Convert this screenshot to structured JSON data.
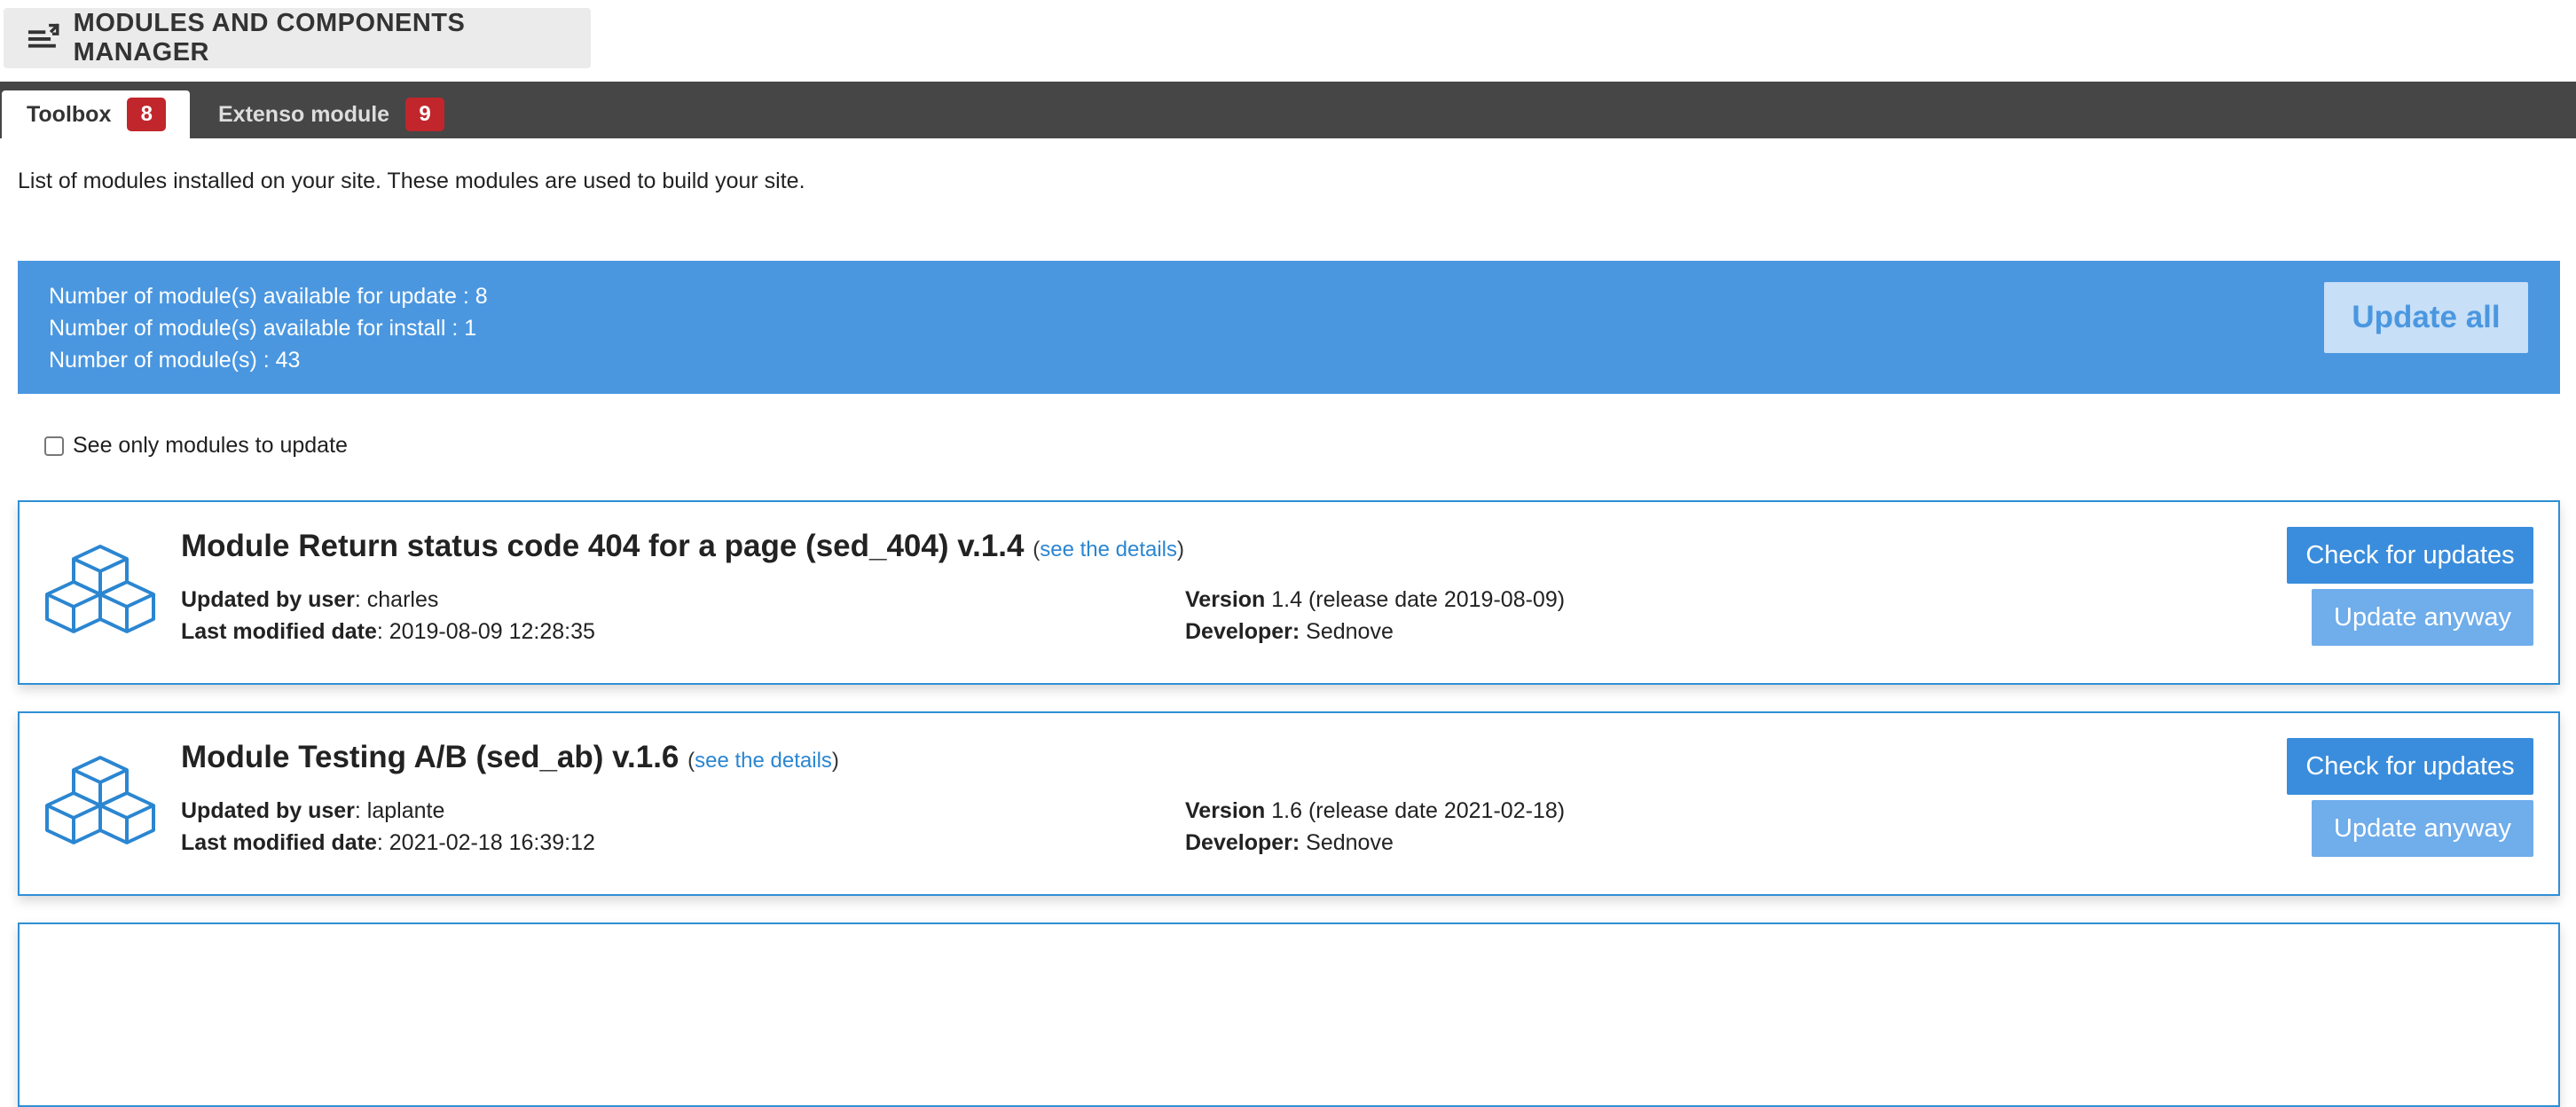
{
  "header": {
    "title": "MODULES AND COMPONENTS MANAGER",
    "icon": "module-settings-icon"
  },
  "tabs": [
    {
      "label": "Toolbox",
      "count": "8",
      "active": true
    },
    {
      "label": "Extenso module",
      "count": "9",
      "active": false
    }
  ],
  "intro": "List of modules installed on your site. These modules are used to build your site.",
  "summary": {
    "update_available": "Number of module(s) available for update : 8",
    "install_available": "Number of module(s) available for install : 1",
    "total": "Number of module(s) : 43",
    "update_all_label": "Update all"
  },
  "filter": {
    "label": "See only modules to update"
  },
  "labels": {
    "updated_by": "Updated by user",
    "last_modified": "Last modified date",
    "version": "Version",
    "developer": "Developer:",
    "see_details": "see the details",
    "check_updates": "Check for updates",
    "update_anyway": "Update anyway"
  },
  "modules": [
    {
      "name": "Module Return status code 404 for a page (sed_404) v.1.4",
      "updated_by": "charles",
      "last_modified": "2019-08-09 12:28:35",
      "version": "1.4 (release date 2019-08-09)",
      "developer": "Sednove"
    },
    {
      "name": "Module Testing A/B (sed_ab) v.1.6",
      "updated_by": "laplante",
      "last_modified": "2021-02-18 16:39:12",
      "version": "1.6 (release date 2021-02-18)",
      "developer": "Sednove"
    }
  ],
  "colors": {
    "accent": "#4a97e0",
    "badge": "#c0262c",
    "tabbar": "#464646"
  }
}
